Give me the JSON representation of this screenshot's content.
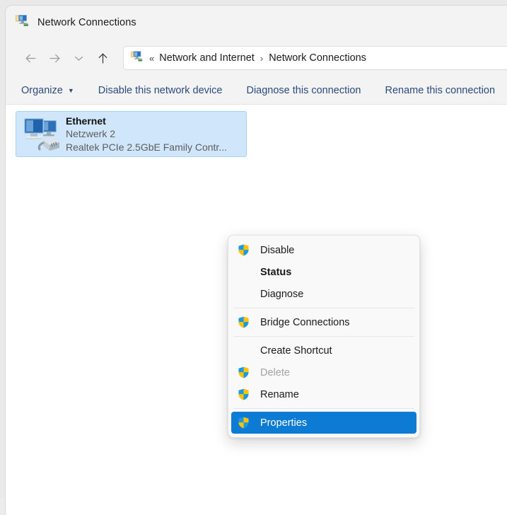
{
  "window": {
    "title": "Network Connections",
    "title_icon": "network-connections-icon"
  },
  "nav": {
    "back_icon": "arrow-left-icon",
    "forward_icon": "arrow-right-icon",
    "recent_icon": "chevron-down-icon",
    "up_icon": "arrow-up-icon",
    "back_label": "Back",
    "forward_label": "Forward",
    "recent_label": "Recent locations",
    "up_label": "Up"
  },
  "address": {
    "icon": "network-connections-icon",
    "overflow": "«",
    "crumbs": [
      {
        "label": "Network and Internet"
      },
      {
        "label": "Network Connections"
      }
    ],
    "separator": "›",
    "dropdown_icon": "chevron-down-icon"
  },
  "commandbar": {
    "items": [
      {
        "label": "Organize",
        "has_caret": true,
        "name": "organize-button"
      },
      {
        "label": "Disable this network device",
        "has_caret": false,
        "name": "disable-device-button"
      },
      {
        "label": "Diagnose this connection",
        "has_caret": false,
        "name": "diagnose-connection-button"
      },
      {
        "label": "Rename this connection",
        "has_caret": false,
        "name": "rename-connection-button"
      }
    ],
    "caret_glyph": "▼"
  },
  "connections": [
    {
      "name": "Ethernet",
      "network": "Netzwerk 2",
      "adapter": "Realtek PCIe 2.5GbE Family Contr...",
      "icon": "ethernet-adapter-icon",
      "selected": true
    }
  ],
  "context_menu": {
    "items": [
      {
        "label": "Disable",
        "shield": true,
        "bold": false,
        "disabled": false,
        "selected": false,
        "name": "menu-item-disable"
      },
      {
        "label": "Status",
        "shield": false,
        "bold": true,
        "disabled": false,
        "selected": false,
        "name": "menu-item-status"
      },
      {
        "label": "Diagnose",
        "shield": false,
        "bold": false,
        "disabled": false,
        "selected": false,
        "name": "menu-item-diagnose"
      },
      {
        "separator": true
      },
      {
        "label": "Bridge Connections",
        "shield": true,
        "bold": false,
        "disabled": false,
        "selected": false,
        "name": "menu-item-bridge-connections"
      },
      {
        "separator": true
      },
      {
        "label": "Create Shortcut",
        "shield": false,
        "bold": false,
        "disabled": false,
        "selected": false,
        "name": "menu-item-create-shortcut"
      },
      {
        "label": "Delete",
        "shield": true,
        "bold": false,
        "disabled": true,
        "selected": false,
        "name": "menu-item-delete"
      },
      {
        "label": "Rename",
        "shield": true,
        "bold": false,
        "disabled": false,
        "selected": false,
        "name": "menu-item-rename"
      },
      {
        "separator": true
      },
      {
        "label": "Properties",
        "shield": true,
        "bold": false,
        "disabled": false,
        "selected": true,
        "name": "menu-item-properties"
      }
    ],
    "shield_icon": "uac-shield-icon"
  },
  "colors": {
    "accent": "#0d7bd4",
    "selection": "#cfe6fb",
    "command_link": "#2b4a7d",
    "chrome": "#f3f3f3",
    "menu_bg": "#f9f9f9",
    "shield_blue": "#1a9ae0",
    "shield_yellow": "#ffc300"
  }
}
